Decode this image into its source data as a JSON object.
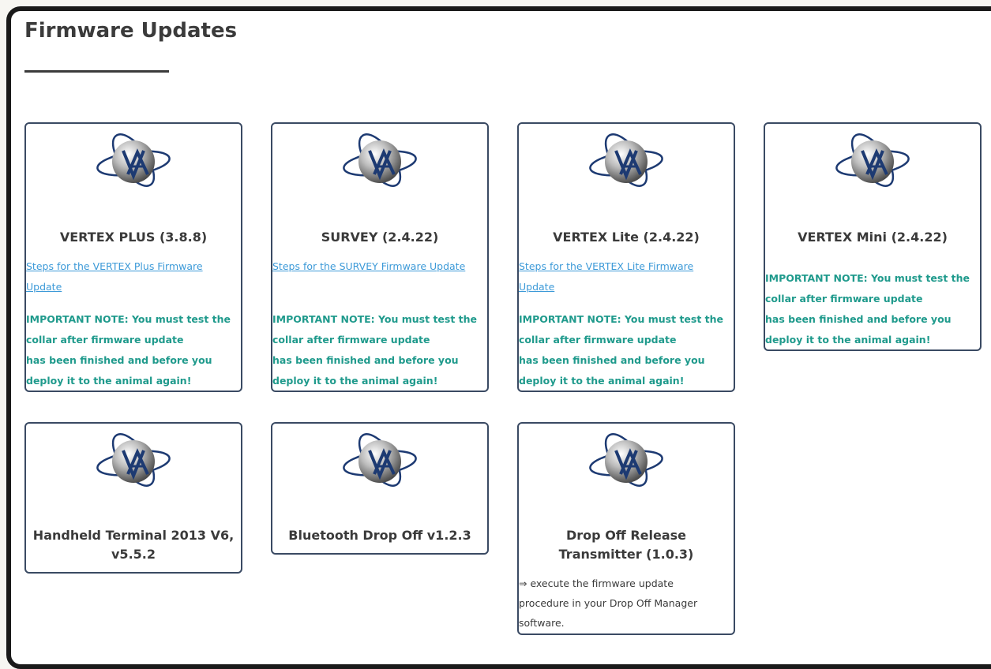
{
  "page": {
    "title": "Firmware Updates"
  },
  "cards": [
    {
      "title": "VERTEX PLUS (3.8.8)",
      "link": "Steps for the VERTEX Plus Firmware Update",
      "note": [
        "IMPORTANT NOTE: You must test the",
        "collar after firmware update",
        "has been finished and before you",
        "deploy it to the animal again!"
      ]
    },
    {
      "title": "SURVEY (2.4.22)",
      "link": "Steps for the SURVEY Firmware Update",
      "note": [
        "IMPORTANT NOTE: You must test the",
        "collar after firmware update",
        "has been finished and before you",
        "deploy it to the animal again!"
      ]
    },
    {
      "title": "VERTEX Lite (2.4.22)",
      "link": "Steps for the VERTEX Lite Firmware Update",
      "note": [
        "IMPORTANT NOTE: You must test the",
        "collar after firmware update",
        "has been finished and before you",
        "deploy it to the animal again!"
      ]
    },
    {
      "title": "VERTEX Mini (2.4.22)",
      "note": [
        "IMPORTANT NOTE: You must test the",
        "collar after firmware update",
        "has been finished and before you",
        "deploy it to the animal again!"
      ]
    },
    {
      "title": "Handheld Terminal 2013 V6, v5.5.2"
    },
    {
      "title": "Bluetooth Drop Off v1.2.3"
    },
    {
      "title": "Drop Off Release Transmitter (1.0.3)",
      "text": [
        "⇒ execute the firmware update",
        "procedure in your Drop Off Manager",
        "software."
      ]
    }
  ],
  "colors": {
    "link": "#3d9ad8",
    "note": "#1f9a8c",
    "card_border": "#3a4a63",
    "title": "#3a3a3a"
  },
  "icons": {
    "card_logo": "vectronic-aerospace-globe-logo-icon"
  }
}
